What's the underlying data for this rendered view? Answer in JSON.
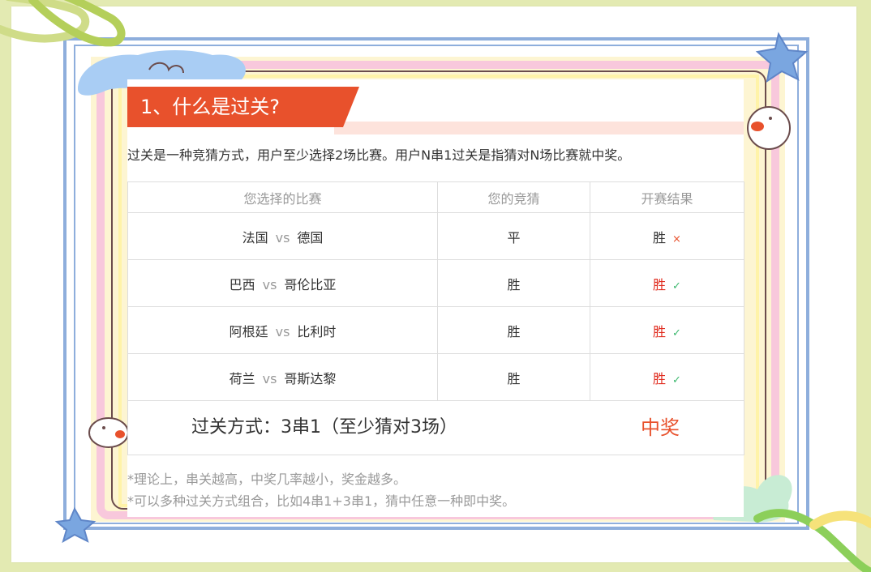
{
  "section": {
    "title": "1、什么是过关?",
    "intro": "过关是一种竞猜方式，用户至少选择2场比赛。用户N串1过关是指猜对N场比赛就中奖。"
  },
  "table": {
    "headers": [
      "您选择的比赛",
      "您的竞猜",
      "开赛结果"
    ],
    "vs_label": "vs",
    "rows": [
      {
        "home": "法国",
        "away": "德国",
        "guess": "平",
        "result": "胜",
        "mark": "×",
        "hit": false
      },
      {
        "home": "巴西",
        "away": "哥伦比亚",
        "guess": "胜",
        "result": "胜",
        "mark": "✓",
        "hit": true
      },
      {
        "home": "阿根廷",
        "away": "比利时",
        "guess": "胜",
        "result": "胜",
        "mark": "✓",
        "hit": true
      },
      {
        "home": "荷兰",
        "away": "哥斯达黎",
        "guess": "胜",
        "result": "胜",
        "mark": "✓",
        "hit": true
      }
    ],
    "summary": {
      "label": "过关方式：3串1（至少猜对3场）",
      "result": "中奖"
    }
  },
  "notes": [
    "*理论上，串关越高，中奖几率越小，奖金越多。",
    "*可以多种过关方式组合，比如4串1+3串1，猜中任意一种即中奖。"
  ],
  "colors": {
    "accent": "#e8512c",
    "win_red": "#e02a1d",
    "check_green": "#3cb86e",
    "background": "#e3eab2"
  },
  "icons": [
    "cloud-icon",
    "star-icon",
    "paperclip-icon",
    "bunny-icon",
    "cross-icon",
    "check-icon"
  ]
}
